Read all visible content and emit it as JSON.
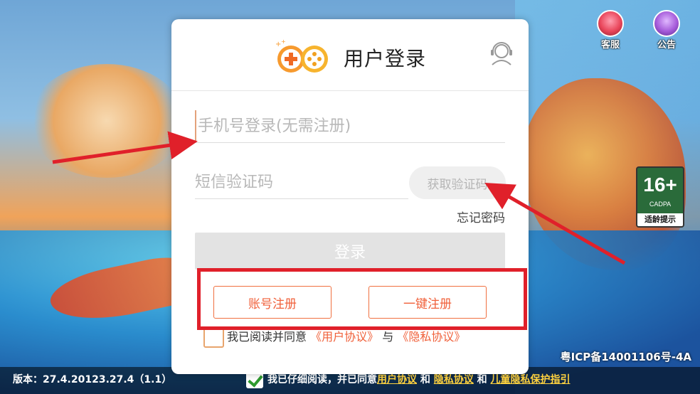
{
  "dialog": {
    "title": "用户登录",
    "phone_placeholder": "手机号登录(无需注册)",
    "code_placeholder": "短信验证码",
    "get_code_label": "获取验证码",
    "forgot_label": "忘记密码",
    "login_label": "登录",
    "account_register_label": "账号注册",
    "quick_register_label": "一键注册",
    "agree": {
      "prefix": "我已阅读并同意",
      "user_agreement": "《用户协议》",
      "conj": "与",
      "privacy_agreement": "《隐私协议》"
    }
  },
  "corner": {
    "service_label": "客服",
    "notice_label": "公告"
  },
  "age_badge": {
    "rating": "16+",
    "org": "CADPA",
    "tip": "适龄提示"
  },
  "footer": {
    "version": "版本：27.4.20123.27.4（1.1）",
    "icp": "粤ICP备14001106号-4A",
    "consent_prefix": "我已仔细阅读，并已同意",
    "consent_user": "用户协议",
    "consent_and1": "和",
    "consent_privacy": "隐私协议",
    "consent_and2": "和",
    "consent_child": "儿童隐私保护指引"
  },
  "colors": {
    "accent_orange": "#f0603a",
    "annotation_red": "#e0202a"
  }
}
